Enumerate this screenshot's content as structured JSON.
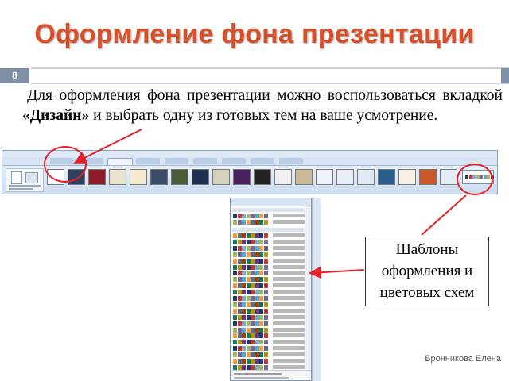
{
  "slide": {
    "title": "Оформление фона презентации",
    "number": "8",
    "intro_part1": "Для оформления фона презентации можно воспользоваться вкладкой ",
    "intro_bold": "«Дизайн»",
    "intro_part2": " и выбрать одну из готовых тем на ваше усмотрение.",
    "callout": "Шаблоны оформления и цветовых  схем",
    "author": "Бронникова Елена"
  },
  "colors": {
    "title": "#d8502a",
    "accent_bar": "#7e8fa6",
    "annotation": "#e5202a"
  },
  "ribbon": {
    "tabs_count": 9,
    "active_tab_index": 2,
    "themes_count": 20
  },
  "dropdown": {
    "rows_count": 24
  }
}
